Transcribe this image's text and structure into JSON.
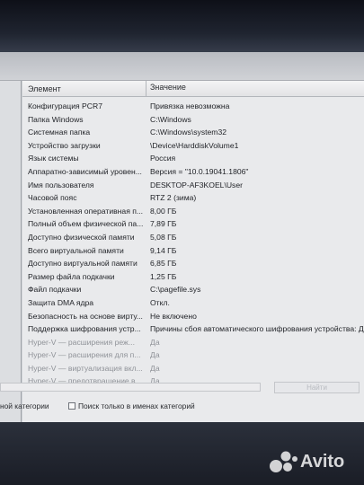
{
  "list": {
    "columns": {
      "name": "Элемент",
      "value": "Значение"
    },
    "rows": [
      {
        "name": "Конфигурация PCR7",
        "value": "Привязка невозможна"
      },
      {
        "name": "Папка Windows",
        "value": "C:\\Windows"
      },
      {
        "name": "Системная папка",
        "value": "C:\\Windows\\system32"
      },
      {
        "name": "Устройство загрузки",
        "value": "\\Device\\HarddiskVolume1"
      },
      {
        "name": "Язык системы",
        "value": "Россия"
      },
      {
        "name": "Аппаратно-зависимый уровен...",
        "value": "Версия = \"10.0.19041.1806\""
      },
      {
        "name": "Имя пользователя",
        "value": "DESKTOP-AF3KOEL\\User"
      },
      {
        "name": "Часовой пояс",
        "value": "RTZ 2 (зима)"
      },
      {
        "name": "Установленная оперативная п...",
        "value": "8,00 ГБ"
      },
      {
        "name": "Полный объем физической па...",
        "value": "7,89 ГБ"
      },
      {
        "name": "Доступно физической памяти",
        "value": "5,08 ГБ"
      },
      {
        "name": "Всего виртуальной памяти",
        "value": "9,14 ГБ"
      },
      {
        "name": "Доступно виртуальной памяти",
        "value": "6,85 ГБ"
      },
      {
        "name": "Размер файла подкачки",
        "value": "1,25 ГБ"
      },
      {
        "name": "Файл подкачки",
        "value": "C:\\pagefile.sys"
      },
      {
        "name": "Защита DMA ядра",
        "value": "Откл."
      },
      {
        "name": "Безопасность на основе вирту...",
        "value": "Не включено"
      },
      {
        "name": "Поддержка шифрования устр...",
        "value": "Причины сбоя автоматического шифрования устройства: Д"
      },
      {
        "name": "Hyper-V — расширения реж...",
        "value": "Да"
      },
      {
        "name": "Hyper-V — расширения для п...",
        "value": "Да"
      },
      {
        "name": "Hyper-V — виртуализация вкл...",
        "value": "Да"
      },
      {
        "name": "Hyper-V — предотвращение в...",
        "value": "Да"
      }
    ]
  },
  "search": {
    "find_button_label": "Найти",
    "option_categories_label": "ной категории",
    "option_search_names_label": "Поиск только в именах категорий"
  },
  "watermark": {
    "text": "Avito"
  }
}
